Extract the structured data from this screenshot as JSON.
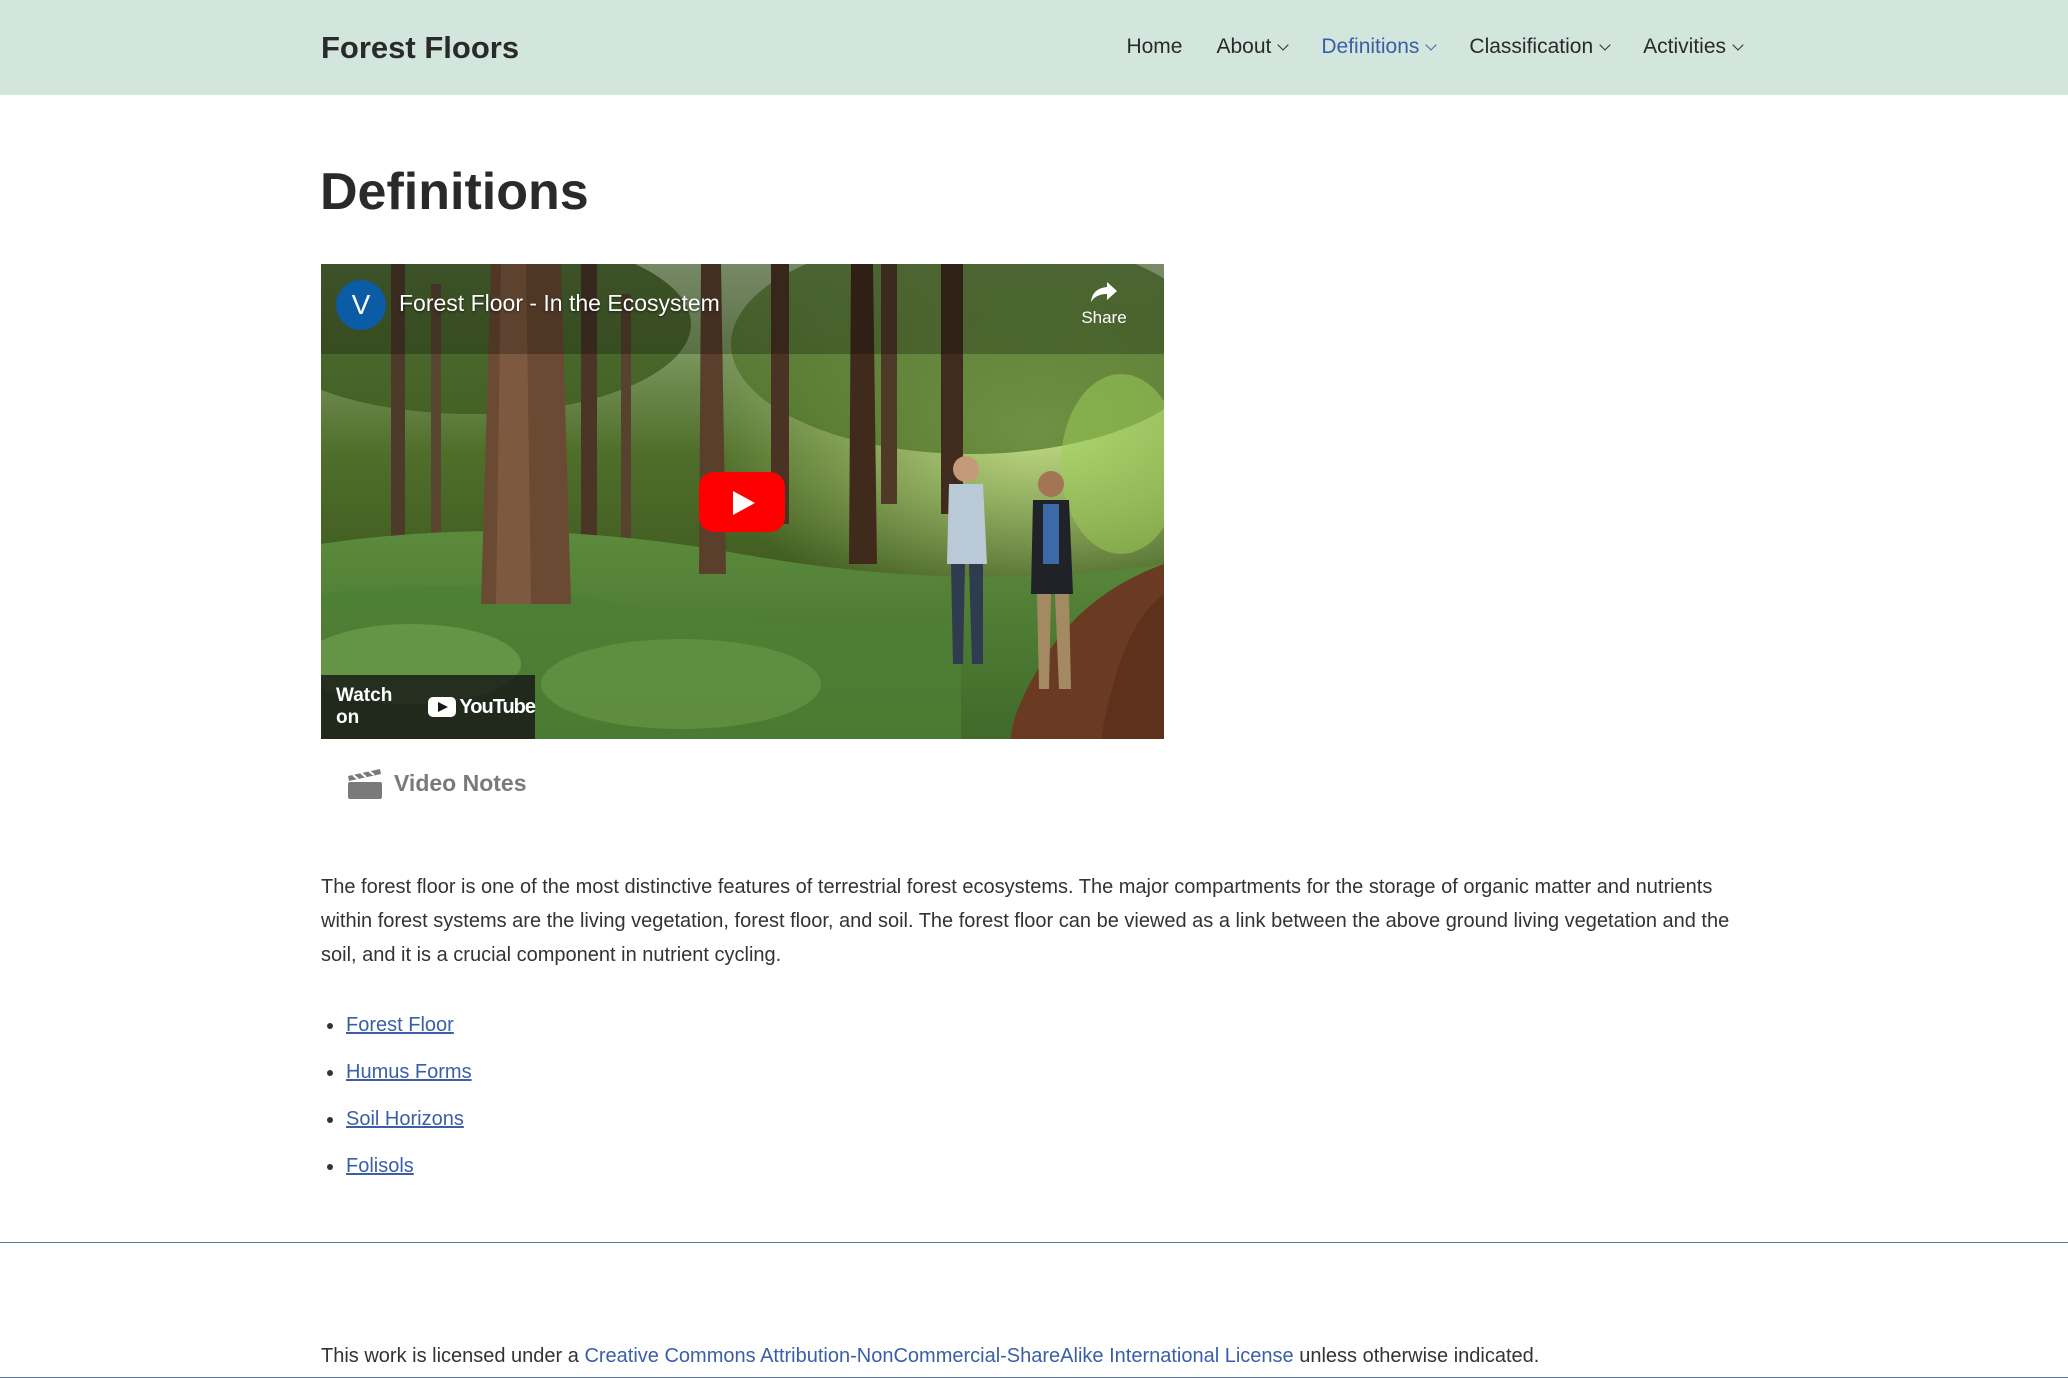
{
  "header": {
    "site_title": "Forest Floors",
    "nav": [
      {
        "label": "Home",
        "has_dropdown": false,
        "active": false
      },
      {
        "label": "About",
        "has_dropdown": true,
        "active": false
      },
      {
        "label": "Definitions",
        "has_dropdown": true,
        "active": true
      },
      {
        "label": "Classification",
        "has_dropdown": true,
        "active": false
      },
      {
        "label": "Activities",
        "has_dropdown": true,
        "active": false
      }
    ],
    "background_color": "#d2e6dd",
    "active_color": "#3a5fa8"
  },
  "main": {
    "page_title": "Definitions",
    "video": {
      "channel_initial": "V",
      "title": "Forest Floor - In the Ecosystem",
      "share_label": "Share",
      "watch_on_label": "Watch on",
      "youtube_label": "YouTube"
    },
    "video_notes_label": "Video Notes",
    "intro": "The forest floor is one of the most distinctive features of terrestrial forest ecosystems. The major compartments for the storage of organic matter and nutrients within forest systems are the living vegetation, forest floor, and soil. The forest floor can be viewed as a link between the above ground living vegetation and the soil, and it is a crucial component in nutrient cycling.",
    "links": [
      {
        "label": "Forest Floor"
      },
      {
        "label": "Humus Forms"
      },
      {
        "label": "Soil Horizons"
      },
      {
        "label": "Folisols"
      }
    ]
  },
  "footer": {
    "license_prefix": "This work is licensed under a ",
    "license_link": "Creative Commons Attribution-NonCommercial-ShareAlike International License",
    "license_suffix": " unless otherwise indicated."
  }
}
